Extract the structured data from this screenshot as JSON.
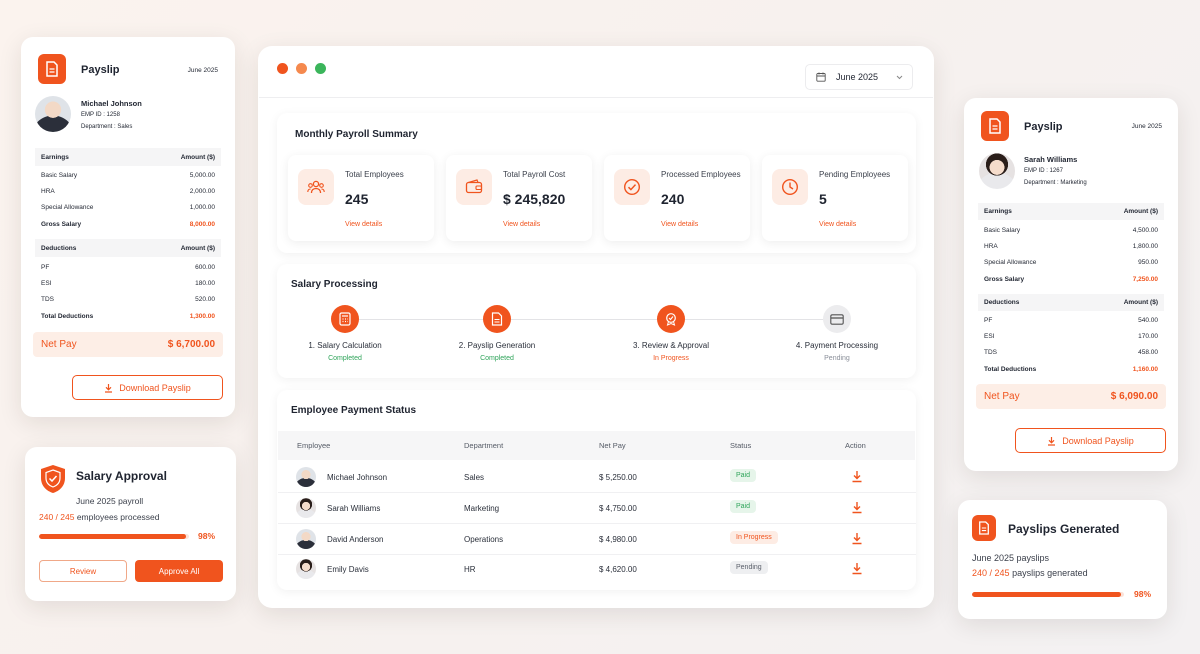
{
  "payslip_left": {
    "title": "Payslip",
    "period": "June 2025",
    "name": "Michael Johnson",
    "emp_id": "EMP ID : 1258",
    "department": "Department : Sales",
    "earnings_header": "Earnings",
    "amount_header": "Amount ($)",
    "earnings": [
      {
        "label": "Basic Salary",
        "value": "5,000.00"
      },
      {
        "label": "HRA",
        "value": "2,000.00"
      },
      {
        "label": "Special Allowance",
        "value": "1,000.00"
      }
    ],
    "gross_label": "Gross Salary",
    "gross_value": "8,000.00",
    "deductions_header": "Deductions",
    "deductions": [
      {
        "label": "PF",
        "value": "600.00"
      },
      {
        "label": "ESI",
        "value": "180.00"
      },
      {
        "label": "TDS",
        "value": "520.00"
      }
    ],
    "total_ded_label": "Total Deductions",
    "total_ded_value": "1,300.00",
    "net_label": "Net Pay",
    "net_value": "$ 6,700.00",
    "download_label": "Download Payslip"
  },
  "approval": {
    "title": "Salary Approval",
    "subtitle": "June 2025 payroll",
    "count": "240 / 245",
    "count_suffix": "employees processed",
    "percent": "98%",
    "progress": 0.98,
    "review_label": "Review",
    "approve_label": "Approve All"
  },
  "window": {
    "month": "June 2025",
    "summary_title": "Monthly Payroll Summary",
    "stats": [
      {
        "label": "Total Employees",
        "value": "245",
        "link": "View details",
        "icon": "users-icon"
      },
      {
        "label": "Total Payroll Cost",
        "value": "$ 245,820",
        "link": "View details",
        "icon": "wallet-icon"
      },
      {
        "label": "Processed Employees",
        "value": "240",
        "link": "View details",
        "icon": "check-circle-icon"
      },
      {
        "label": "Pending Employees",
        "value": "5",
        "link": "View details",
        "icon": "clock-icon"
      }
    ],
    "processing_title": "Salary Processing",
    "steps": [
      {
        "label": "1. Salary Calculation",
        "status": "Completed"
      },
      {
        "label": "2. Payslip Generation",
        "status": "Completed"
      },
      {
        "label": "3. Review & Approval",
        "status": "In Progress"
      },
      {
        "label": "4. Payment Processing",
        "status": "Pending"
      }
    ],
    "status_title": "Employee Payment Status",
    "columns": [
      "Employee",
      "Department",
      "Net Pay",
      "Status",
      "Action"
    ],
    "rows": [
      {
        "name": "Michael Johnson",
        "dept": "Sales",
        "pay": "$ 5,250.00",
        "status": "Paid"
      },
      {
        "name": "Sarah Williams",
        "dept": "Marketing",
        "pay": "$ 4,750.00",
        "status": "Paid"
      },
      {
        "name": "David Anderson",
        "dept": "Operations",
        "pay": "$ 4,980.00",
        "status": "In Progress"
      },
      {
        "name": "Emily Davis",
        "dept": "HR",
        "pay": "$ 4,620.00",
        "status": "Pending"
      }
    ]
  },
  "payslip_right": {
    "title": "Payslip",
    "period": "June 2025",
    "name": "Sarah Williams",
    "emp_id": "EMP ID : 1267",
    "department": "Department : Marketing",
    "earnings_header": "Earnings",
    "amount_header": "Amount ($)",
    "earnings": [
      {
        "label": "Basic Salary",
        "value": "4,500.00"
      },
      {
        "label": "HRA",
        "value": "1,800.00"
      },
      {
        "label": "Special Allowance",
        "value": "950.00"
      }
    ],
    "gross_label": "Gross Salary",
    "gross_value": "7,250.00",
    "deductions_header": "Deductions",
    "deductions": [
      {
        "label": "PF",
        "value": "540.00"
      },
      {
        "label": "ESI",
        "value": "170.00"
      },
      {
        "label": "TDS",
        "value": "458.00"
      }
    ],
    "total_ded_label": "Total Deductions",
    "total_ded_value": "1,160.00",
    "net_label": "Net Pay",
    "net_value": "$ 6,090.00",
    "download_label": "Download Payslip"
  },
  "generated": {
    "title": "Payslips Generated",
    "subtitle": "June 2025 payslips",
    "count": "240 / 245",
    "count_suffix": "payslips generated",
    "percent": "98%",
    "progress": 0.98
  },
  "colors": {
    "accent": "#f0541e",
    "success": "#2fa45a",
    "dot_red": "#f0541e",
    "dot_orange": "#f5894e",
    "dot_green": "#3bb55b"
  }
}
